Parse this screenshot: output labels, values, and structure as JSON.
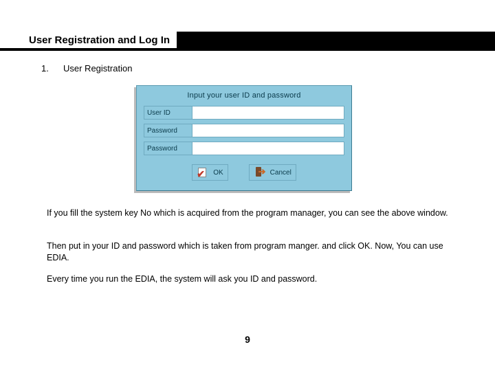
{
  "header": {
    "title": "User Registration and Log In"
  },
  "section": {
    "number": "1.",
    "title": "User Registration"
  },
  "dialog": {
    "caption": "Input your user ID and password",
    "label_userid": "User ID",
    "label_password1": "Password",
    "label_password2": "Password",
    "ok_label": "OK",
    "cancel_label": "Cancel"
  },
  "body": {
    "p1": "If you fill the system key No which is acquired from the program manager, you can see the above window.",
    "p2": "Then put in your ID and password which is taken from program manger. and click OK. Now, You can use EDIA.",
    "p3": "Every time you run the EDIA, the system will ask you ID and password."
  },
  "page_number": "9"
}
